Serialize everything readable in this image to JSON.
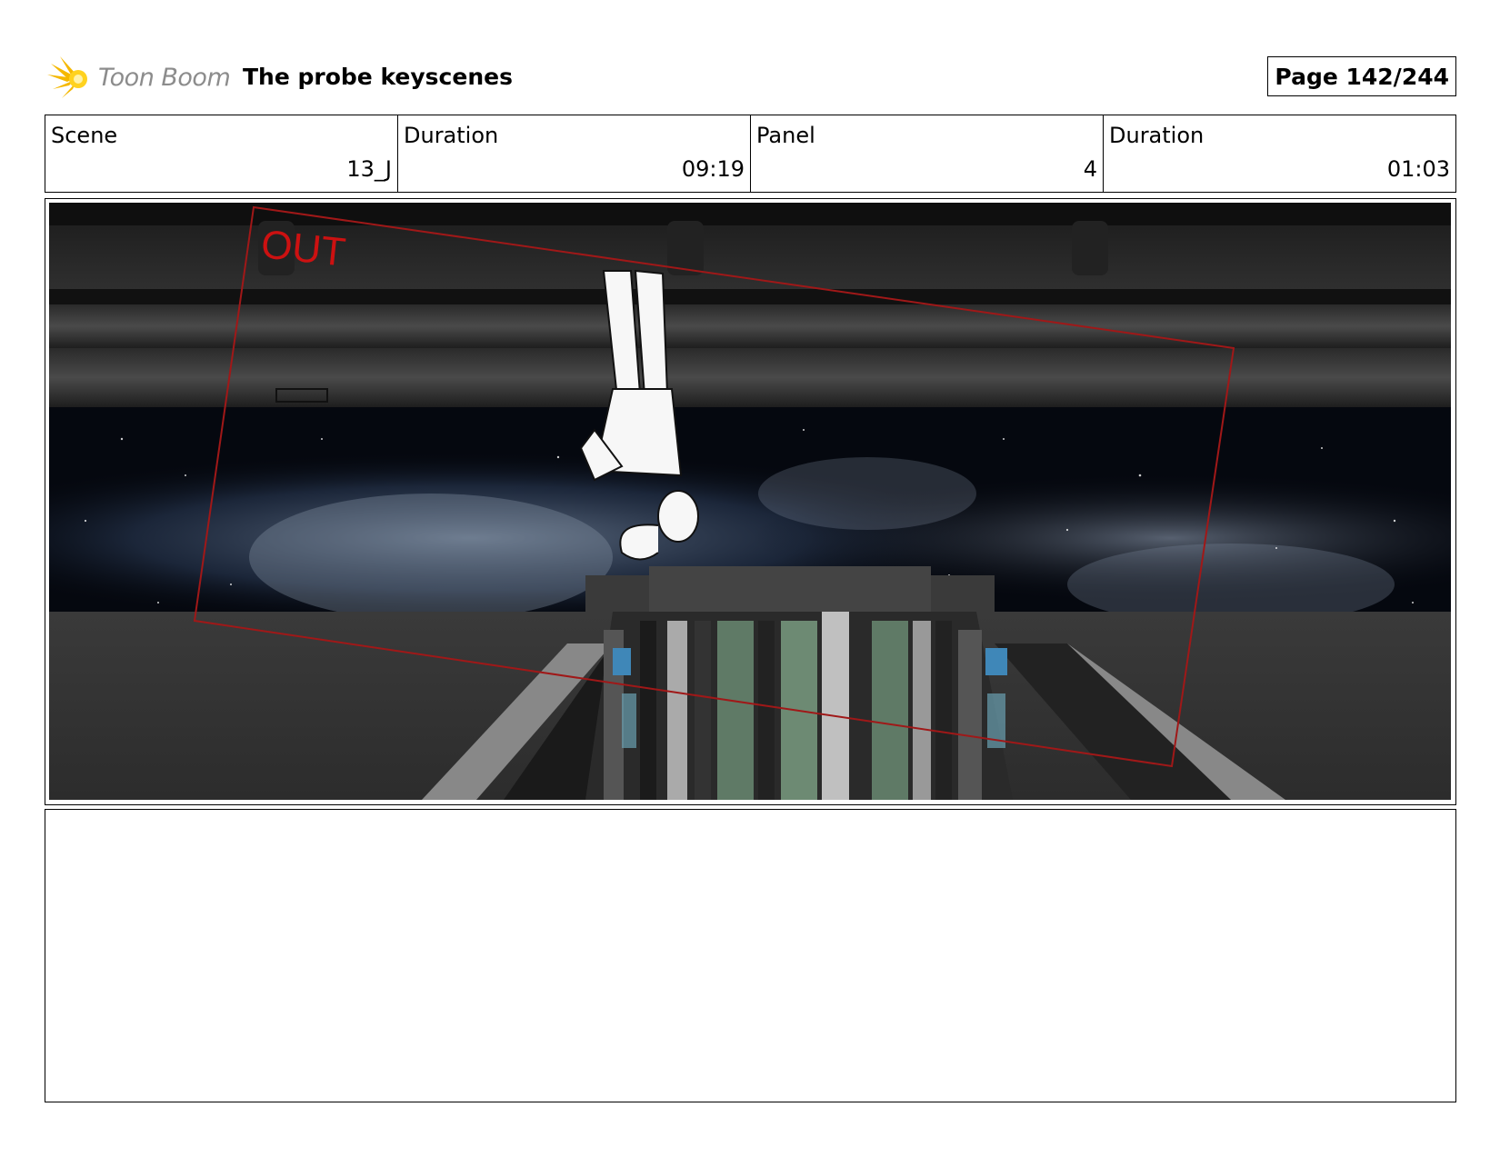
{
  "header": {
    "logo_text": "Toon Boom",
    "title": "The probe keyscenes",
    "page_label": "Page 142/244"
  },
  "info": [
    {
      "label": "Scene",
      "value": "13_J"
    },
    {
      "label": "Duration",
      "value": "09:19"
    },
    {
      "label": "Panel",
      "value": "4"
    },
    {
      "label": "Duration",
      "value": "01:03"
    }
  ],
  "panel": {
    "annotation": "OUT",
    "annotation_color": "#cc1111"
  },
  "notes": ""
}
